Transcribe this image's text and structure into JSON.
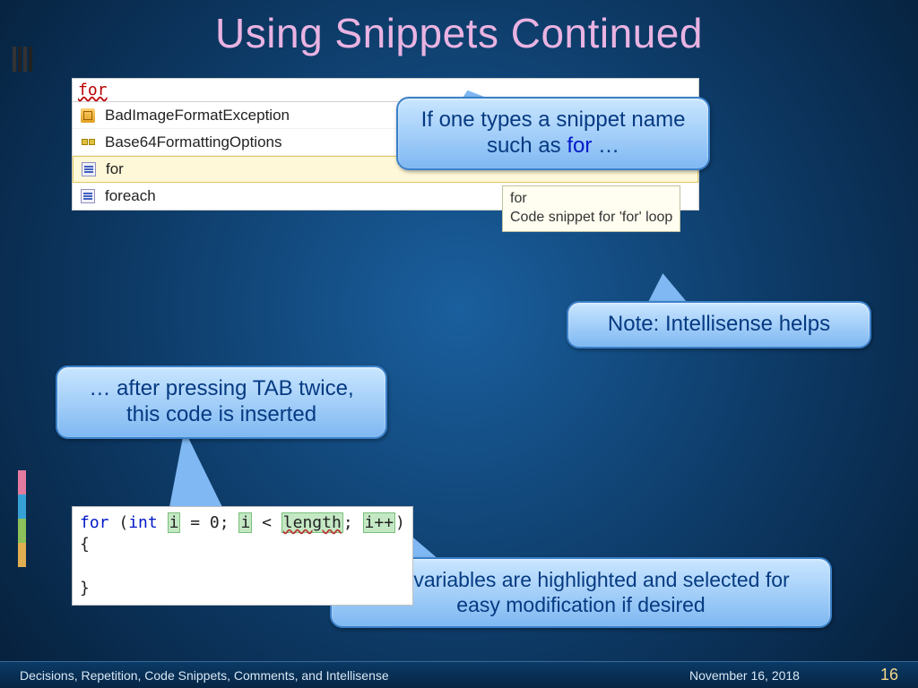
{
  "title": "Using Snippets Continued",
  "intellisense": {
    "typed": "for",
    "items": [
      {
        "icon": "class",
        "label": "BadImageFormatException"
      },
      {
        "icon": "enum",
        "label": "Base64FormattingOptions"
      },
      {
        "icon": "snippet",
        "label": "for",
        "selected": true
      },
      {
        "icon": "snippet",
        "label": "foreach"
      }
    ],
    "tooltip_line1": "for",
    "tooltip_line2": "Code snippet for 'for' loop"
  },
  "callouts": {
    "c1_prefix": "If one types a snippet name such as ",
    "c1_kw": "for",
    "c1_suffix": " …",
    "c2": "Note: Intellisense helps",
    "c3": "… after pressing TAB twice, this code is inserted",
    "c4": "The variables are highlighted and selected for easy modification if desired"
  },
  "code": {
    "line1_kw1": "for",
    "line1_open": " (",
    "line1_kw2": "int",
    "line1_sp": " ",
    "line1_i1": "i",
    "line1_eq": " = 0; ",
    "line1_i2": "i",
    "line1_lt": " < ",
    "line1_len": "length",
    "line1_sc": "; ",
    "line1_i3": "i++",
    "line1_close": ")",
    "line2": "{",
    "line3": "",
    "line4": "}"
  },
  "footer": {
    "left": "Decisions, Repetition, Code Snippets, Comments, and Intellisense",
    "date": "November 16, 2018",
    "page": "16"
  },
  "colors": {
    "bars": [
      "#e57aa0",
      "#37a1d6",
      "#8bc05a",
      "#e0b050"
    ]
  }
}
